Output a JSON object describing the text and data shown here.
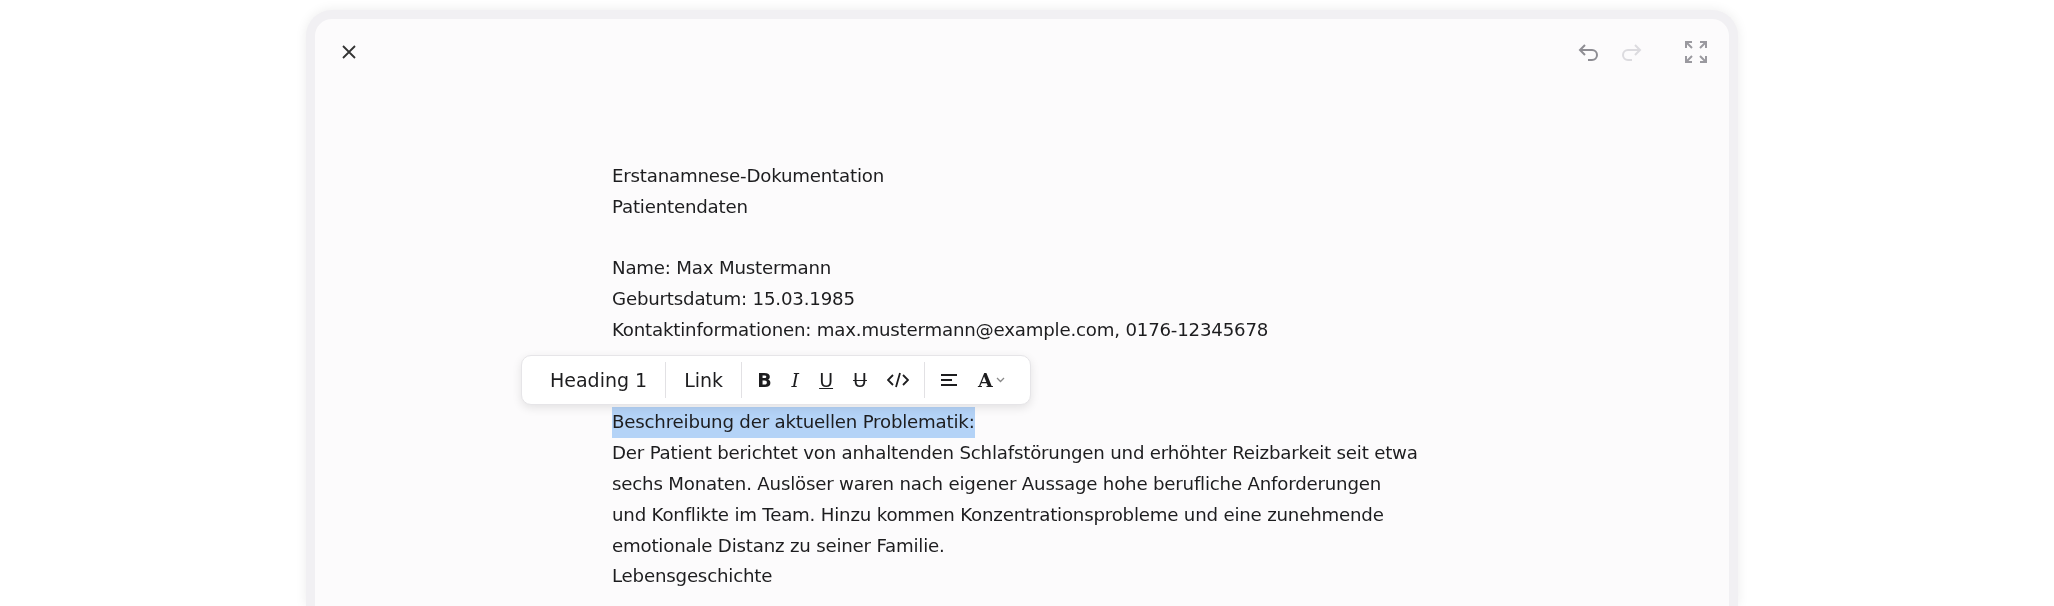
{
  "header": {
    "history": [
      {
        "kind": "undo",
        "disabled": false
      },
      {
        "kind": "redo",
        "disabled": true
      }
    ]
  },
  "document": {
    "lines": [
      {
        "kind": "text",
        "text": "Erstanamnese-Dokumentation",
        "selected": false
      },
      {
        "kind": "text",
        "text": "Patientendaten",
        "selected": false
      },
      {
        "kind": "spacer"
      },
      {
        "kind": "text",
        "text": "Name: Max Mustermann",
        "selected": false
      },
      {
        "kind": "text",
        "text": "Geburtsdatum: 15.03.1985",
        "selected": false
      },
      {
        "kind": "text",
        "text": "Kontaktinformationen: max.mustermann@example.com, 0176-12345678",
        "selected": false
      },
      {
        "kind": "spacer"
      },
      {
        "kind": "spacer"
      },
      {
        "kind": "text",
        "text": "Beschreibung der aktuellen Problematik:",
        "selected": true
      },
      {
        "kind": "text",
        "text": "Der Patient berichtet von anhaltenden Schlafstörungen und erhöhter Reizbarkeit seit etwa",
        "selected": false
      },
      {
        "kind": "text",
        "text": "sechs Monaten. Auslöser waren nach eigener Aussage hohe berufliche Anforderungen",
        "selected": false
      },
      {
        "kind": "text",
        "text": "und Konflikte im Team. Hinzu kommen Konzentrationsprobleme und eine zunehmende",
        "selected": false
      },
      {
        "kind": "text",
        "text": "emotionale Distanz zu seiner Familie.",
        "selected": false
      },
      {
        "kind": "text",
        "text": "Lebensgeschichte",
        "selected": false
      }
    ]
  },
  "toolbar": {
    "groups": [
      [
        {
          "kind": "text",
          "label": "Heading 1"
        }
      ],
      [
        {
          "kind": "text",
          "label": "Link"
        }
      ],
      [
        {
          "kind": "bold",
          "label": "B"
        },
        {
          "kind": "italic",
          "label": "I"
        },
        {
          "kind": "underline",
          "label": "U"
        },
        {
          "kind": "strike",
          "label": "U"
        },
        {
          "kind": "code"
        }
      ],
      [
        {
          "kind": "align"
        },
        {
          "kind": "font",
          "label": "A"
        }
      ]
    ]
  }
}
